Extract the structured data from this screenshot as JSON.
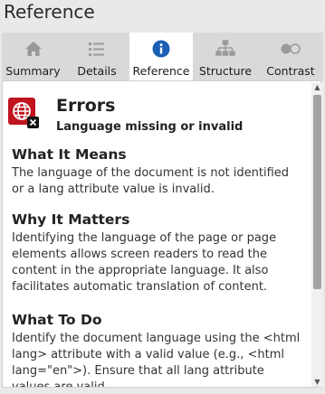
{
  "panel": {
    "title": "Reference"
  },
  "tabs": [
    {
      "label": "Summary",
      "icon": "home-icon"
    },
    {
      "label": "Details",
      "icon": "list-icon"
    },
    {
      "label": "Reference",
      "icon": "info-icon",
      "active": true
    },
    {
      "label": "Structure",
      "icon": "hierarchy-icon"
    },
    {
      "label": "Contrast",
      "icon": "toggle-icon"
    }
  ],
  "reference": {
    "category": "Errors",
    "subtitle": "Language missing or invalid",
    "icon": "globe-error-icon",
    "sections": [
      {
        "heading": "What It Means",
        "body": "The language of the document is not identified or a lang attribute value is invalid."
      },
      {
        "heading": "Why It Matters",
        "body": "Identifying the language of the page or page elements allows screen readers to read the content in the appropriate language. It also facilitates automatic translation of content."
      },
      {
        "heading": "What To Do",
        "body": "Identify the document language using the <html lang> attribute with a valid value (e.g., <html lang=\"en\">). Ensure that all lang attribute values are valid."
      }
    ]
  },
  "colors": {
    "accent": "#1a5fb4",
    "error": "#c0141e",
    "tab_bg": "#d9d9d9",
    "active_tab_bg": "#ffffff"
  }
}
